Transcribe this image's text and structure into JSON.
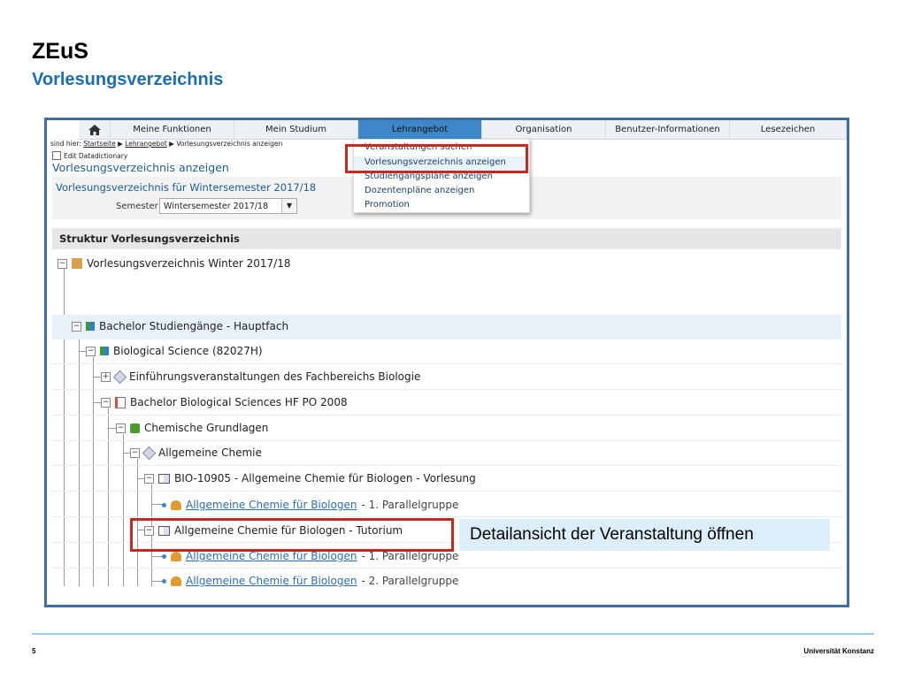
{
  "slide": {
    "title": "ZEuS",
    "subtitle": "Vorlesungsverzeichnis",
    "page_number": "5",
    "footer": "Universität Konstanz"
  },
  "nav": {
    "home_icon": "house-icon",
    "items": [
      "Meine Funktionen",
      "Mein Studium",
      "Lehrangebot",
      "Organisation",
      "Benutzer-Informationen",
      "Lesezeichen"
    ],
    "active": "Lehrangebot",
    "active_color": "#3d87c9"
  },
  "breadcrumb": {
    "prefix": "sind hier:",
    "home": "Startseite",
    "sep": "▶",
    "section": "Lehrangebot",
    "current": "Vorlesungsverzeichnis anzeigen"
  },
  "edit_datadictionary": "Edit Datadictionary",
  "page_heading": "Vorlesungsverzeichnis anzeigen",
  "vv_title": "Vorlesungsverzeichnis für Wintersemester 2017/18",
  "semester": {
    "label": "Semester",
    "value": "Wintersemester 2017/18"
  },
  "dropdown": {
    "items": [
      "Veranstaltungen suchen",
      "Vorlesungsverzeichnis anzeigen",
      "Studiengangspläne anzeigen",
      "Dozentenpläne anzeigen",
      "Promotion"
    ],
    "highlighted": "Vorlesungsverzeichnis anzeigen"
  },
  "tree": {
    "header": "Struktur Vorlesungsverzeichnis",
    "root": "Vorlesungsverzeichnis Winter 2017/18",
    "bachelor": "Bachelor Studiengänge - Hauptfach",
    "biosci": "Biological Science (82027H)",
    "intro": "Einführungsveranstaltungen des Fachbereichs Biologie",
    "po2008": "Bachelor Biological Sciences HF PO 2008",
    "chem_basics": "Chemische Grundlagen",
    "gen_chem": "Allgemeine Chemie",
    "lecture": "BIO-10905 - Allgemeine Chemie für Biologen - Vorlesung",
    "lecture_group_link": "Allgemeine Chemie für Biologen",
    "lecture_group_suffix": "- 1. Parallelgruppe",
    "tutorial": "Allgemeine Chemie für Biologen - Tutorium",
    "tut_group1_link": "Allgemeine Chemie für Biologen",
    "tut_group1_suffix": "- 1. Parallelgruppe",
    "tut_group2_link": "Allgemeine Chemie für Biologen",
    "tut_group2_suffix": "- 2. Parallelgruppe"
  },
  "callout": "Detailansicht der Veranstaltung öffnen",
  "colors": {
    "highlight_red": "#c8281e",
    "frame_blue": "#3d6e9e",
    "title_blue": "#1a6fb5"
  }
}
